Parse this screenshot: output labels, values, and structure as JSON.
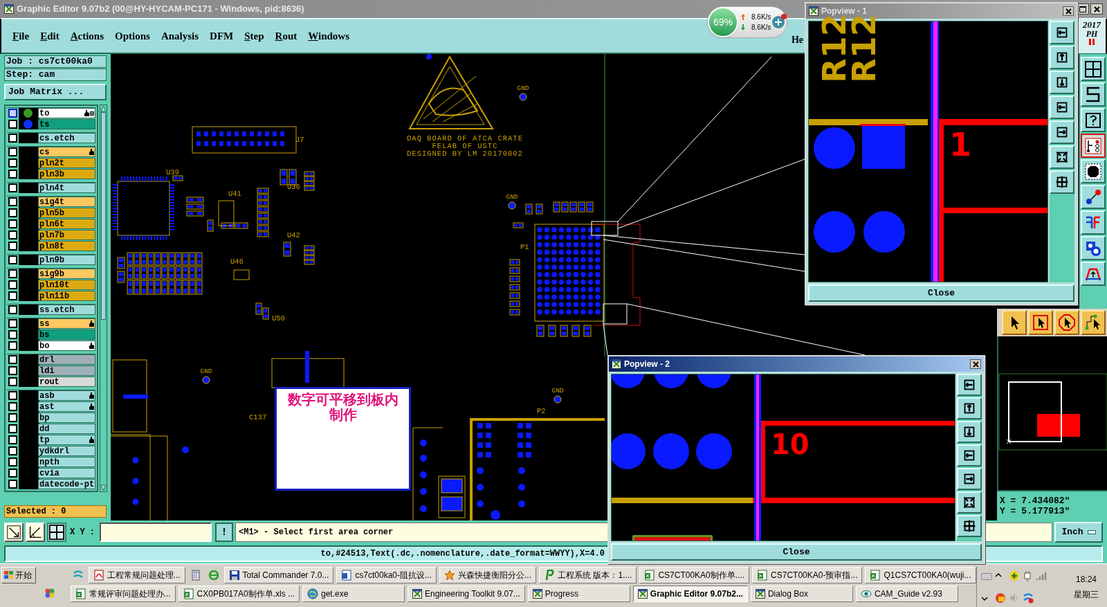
{
  "window": {
    "title": "Graphic Editor 9.07b2 (00@HY-HYCAM-PC171 - Windows, pid:8636)"
  },
  "net_meter": {
    "percent": "69%",
    "upload": "8.6K/s",
    "download": "8.6K/s"
  },
  "menu": [
    {
      "label": "File",
      "mnemonic": true
    },
    {
      "label": "Edit",
      "mnemonic": true
    },
    {
      "label": "Actions",
      "mnemonic": true
    },
    {
      "label": "Options",
      "mnemonic": false
    },
    {
      "label": "Analysis",
      "mnemonic": false
    },
    {
      "label": "DFM",
      "mnemonic": false
    },
    {
      "label": "Step",
      "mnemonic": true
    },
    {
      "label": "Rout",
      "mnemonic": true
    },
    {
      "label": "Windows",
      "mnemonic": true
    }
  ],
  "help_menu_partial": "He",
  "clock_badge": {
    "year": "2017",
    "period": "PH"
  },
  "job": {
    "job": "Job : cs7ct00ka0",
    "step": "Step: cam",
    "matrix_button": "Job Matrix ..."
  },
  "layer_groups": [
    {
      "layers": [
        {
          "name": "to",
          "color": "#ffffff",
          "checked": false,
          "focused": true,
          "hand": true,
          "grid": true,
          "dot": {
            "color": "#3a9a20"
          }
        },
        {
          "name": "ts",
          "color": "#10a080",
          "checked": false,
          "focused": false,
          "hand": false,
          "grid": false,
          "dot": {
            "color": "#1030ff"
          }
        }
      ]
    },
    {
      "layers": [
        {
          "name": "cs.etch",
          "color": "#a0dcdc",
          "checked": false,
          "focused": false,
          "hand": false,
          "grid": false
        }
      ]
    },
    {
      "layers": [
        {
          "name": "cs",
          "color": "#ffc860",
          "checked": false,
          "focused": false,
          "hand": true,
          "grid": false
        },
        {
          "name": "pln2t",
          "color": "#dcaa10",
          "checked": false,
          "focused": false,
          "hand": false,
          "grid": false
        },
        {
          "name": "pln3b",
          "color": "#dcaa10",
          "checked": false,
          "focused": false,
          "hand": false,
          "grid": false
        }
      ]
    },
    {
      "layers": [
        {
          "name": "pln4t",
          "color": "#a0dcdc",
          "checked": false,
          "focused": false,
          "hand": false,
          "grid": false
        }
      ]
    },
    {
      "layers": [
        {
          "name": "sig4t",
          "color": "#ffc860",
          "checked": false,
          "focused": false,
          "hand": false,
          "grid": false
        },
        {
          "name": "pln5b",
          "color": "#dcaa10",
          "checked": false,
          "focused": false,
          "hand": false,
          "grid": false
        },
        {
          "name": "pln6t",
          "color": "#dcaa10",
          "checked": false,
          "focused": false,
          "hand": false,
          "grid": false
        },
        {
          "name": "pln7b",
          "color": "#dcaa10",
          "checked": false,
          "focused": false,
          "hand": false,
          "grid": false
        },
        {
          "name": "pln8t",
          "color": "#dcaa10",
          "checked": false,
          "focused": false,
          "hand": false,
          "grid": false
        }
      ]
    },
    {
      "layers": [
        {
          "name": "pln9b",
          "color": "#a0dcdc",
          "checked": false,
          "focused": false,
          "hand": false,
          "grid": false
        }
      ]
    },
    {
      "layers": [
        {
          "name": "sig9b",
          "color": "#ffc860",
          "checked": false,
          "focused": false,
          "hand": false,
          "grid": false
        },
        {
          "name": "pln10t",
          "color": "#dcaa10",
          "checked": false,
          "focused": false,
          "hand": false,
          "grid": false
        },
        {
          "name": "pln11b",
          "color": "#dcaa10",
          "checked": false,
          "focused": false,
          "hand": false,
          "grid": false
        }
      ]
    },
    {
      "layers": [
        {
          "name": "ss.etch",
          "color": "#a0dcdc",
          "checked": false,
          "focused": false,
          "hand": false,
          "grid": false
        }
      ]
    },
    {
      "layers": [
        {
          "name": "ss",
          "color": "#ffc860",
          "checked": false,
          "focused": false,
          "hand": true,
          "grid": false
        },
        {
          "name": "bs",
          "color": "#10a080",
          "checked": false,
          "focused": false,
          "hand": false,
          "grid": false
        },
        {
          "name": "bo",
          "color": "#ffffff",
          "checked": false,
          "focused": false,
          "hand": true,
          "grid": false
        }
      ]
    },
    {
      "layers": [
        {
          "name": "drl",
          "color": "#a0b0b8",
          "checked": false,
          "focused": false,
          "hand": false,
          "grid": false
        },
        {
          "name": "ldi",
          "color": "#a0b0b8",
          "checked": false,
          "focused": false,
          "hand": false,
          "grid": false
        },
        {
          "name": "rout",
          "color": "#d8d8d8",
          "checked": false,
          "focused": false,
          "hand": false,
          "grid": false
        }
      ]
    },
    {
      "layers": [
        {
          "name": "asb",
          "color": "#a0dcdc",
          "checked": false,
          "focused": false,
          "hand": true,
          "grid": false
        },
        {
          "name": "ast",
          "color": "#a0dcdc",
          "checked": false,
          "focused": false,
          "hand": true,
          "grid": false
        },
        {
          "name": "bp",
          "color": "#a0dcdc",
          "checked": false,
          "focused": false,
          "hand": false,
          "grid": false
        },
        {
          "name": "dd",
          "color": "#a0dcdc",
          "checked": false,
          "focused": false,
          "hand": false,
          "grid": false
        },
        {
          "name": "tp",
          "color": "#a0dcdc",
          "checked": false,
          "focused": false,
          "hand": true,
          "grid": false
        },
        {
          "name": "ydkdrl",
          "color": "#a0dcdc",
          "checked": false,
          "focused": false,
          "hand": false,
          "grid": false
        },
        {
          "name": "npth",
          "color": "#a0dcdc",
          "checked": false,
          "focused": false,
          "hand": false,
          "grid": false
        },
        {
          "name": "cvia",
          "color": "#a0dcdc",
          "checked": false,
          "focused": false,
          "hand": false,
          "grid": false
        },
        {
          "name": "datecode-pt",
          "color": "#a0dcdc",
          "checked": false,
          "focused": false,
          "hand": false,
          "grid": false
        }
      ]
    }
  ],
  "selected_count": "Selected : 0",
  "canvas": {
    "logo_lines": [
      "DAQ BOARD OF ATCA CRATE",
      "FELAB OF USTC",
      "DESIGNED BY LM 20170802"
    ],
    "labels": [
      {
        "text": "J7",
        "kind": "ref"
      },
      {
        "text": "U39",
        "kind": "ref"
      },
      {
        "text": "U41",
        "kind": "ref"
      },
      {
        "text": "U36",
        "kind": "ref"
      },
      {
        "text": "U42",
        "kind": "ref"
      },
      {
        "text": "U46",
        "kind": "ref"
      },
      {
        "text": "U50",
        "kind": "ref"
      },
      {
        "text": "P1",
        "kind": "ref"
      },
      {
        "text": "P2",
        "kind": "ref"
      },
      {
        "text": "C137",
        "kind": "ref"
      },
      {
        "text": "GND",
        "kind": "gnd"
      },
      {
        "text": "GND",
        "kind": "gnd"
      },
      {
        "text": "GND",
        "kind": "gnd"
      },
      {
        "text": "GND",
        "kind": "gnd"
      }
    ]
  },
  "note": {
    "text": "数字可平移到板内制作"
  },
  "popviews": [
    {
      "title": "Popview - 1",
      "active": false,
      "close_label": "Close",
      "labels": [
        "R12",
        "R12",
        "1"
      ]
    },
    {
      "title": "Popview - 2",
      "active": true,
      "close_label": "Close",
      "labels": [
        "10"
      ]
    }
  ],
  "right_toolbar": [
    {
      "kind": "grid",
      "selected": false
    },
    {
      "kind": "route",
      "selected": false
    },
    {
      "kind": "help",
      "selected": false
    },
    {
      "kind": "netlist",
      "selected": true
    },
    {
      "kind": "pad",
      "selected": false
    },
    {
      "kind": "connect",
      "selected": false
    },
    {
      "kind": "ff",
      "selected": false
    },
    {
      "kind": "shapes",
      "selected": false
    },
    {
      "kind": "arc",
      "selected": false
    }
  ],
  "pointer_tools": [
    {
      "kind": "pointer"
    },
    {
      "kind": "pointer_box"
    },
    {
      "kind": "pointer_octagon"
    },
    {
      "kind": "pointer_net"
    }
  ],
  "view_tools": [
    {
      "kind": "zoom",
      "selected": false
    },
    {
      "kind": "measure",
      "selected": false
    },
    {
      "kind": "grid",
      "selected": true
    }
  ],
  "coordinates": {
    "x": "X = 7.434082\"",
    "y": "Y = 5.177913\""
  },
  "units": "Inch",
  "prompt": {
    "xy_label": "X Y :",
    "action": "!",
    "message": "<M1> - Select first area corner"
  },
  "status_line": "to,#24513,Text(.dc,.nomenclature,.date_format=WWYY),X=4.0",
  "taskbar": {
    "start": "开始",
    "row1": [
      {
        "kind": "launcher"
      },
      {
        "kind": "window",
        "label": "工程常规问题处理...",
        "selected": false
      },
      {
        "kind": "launcher"
      },
      {
        "kind": "launcher"
      },
      {
        "kind": "window",
        "label": "Total Commander 7.0...",
        "selected": false
      },
      {
        "kind": "window",
        "label": "cs7ct00ka0-阻抗设...",
        "selected": false
      },
      {
        "kind": "window",
        "label": "兴森快捷衡阳分公...",
        "selected": false
      },
      {
        "kind": "window",
        "label": "工程系统  版本：1....",
        "selected": false
      },
      {
        "kind": "window",
        "label": "CS7CT00KA0制作单....",
        "selected": false
      },
      {
        "kind": "window",
        "label": "CS7CT00KA0-预审指...",
        "selected": false
      },
      {
        "kind": "window",
        "label": "Q1CS7CT00KA0(wuji...",
        "selected": false
      }
    ],
    "row2": [
      {
        "kind": "launcher"
      },
      {
        "kind": "window",
        "label": "常规评审问题处理办...",
        "selected": false
      },
      {
        "kind": "window",
        "label": "CX0PB017A0制作单.xls ...",
        "selected": false
      },
      {
        "kind": "window",
        "label": "get.exe",
        "selected": false
      },
      {
        "kind": "window",
        "label": "Engineering Toolkit 9.07...",
        "selected": false
      },
      {
        "kind": "window",
        "label": "Progress",
        "selected": false
      },
      {
        "kind": "window",
        "label": "Graphic Editor 9.07b2...",
        "selected": true
      },
      {
        "kind": "window",
        "label": "Dialog Box",
        "selected": false
      },
      {
        "kind": "window",
        "label": "CAM_Guide v2.93",
        "selected": false
      }
    ],
    "time": "18:24",
    "day": "星期三"
  }
}
